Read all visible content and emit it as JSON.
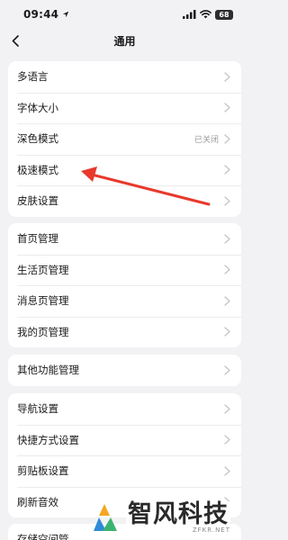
{
  "status_bar": {
    "time": "09:44",
    "battery": "68",
    "icons": [
      "location-arrow-icon",
      "signal-icon",
      "wifi-icon",
      "battery-icon"
    ]
  },
  "nav": {
    "title": "通用",
    "back_icon": "chevron-left-icon"
  },
  "groups": [
    {
      "items": [
        {
          "label": "多语言",
          "value": ""
        },
        {
          "label": "字体大小",
          "value": ""
        },
        {
          "label": "深色模式",
          "value": "已关闭"
        },
        {
          "label": "极速模式",
          "value": ""
        },
        {
          "label": "皮肤设置",
          "value": ""
        }
      ]
    },
    {
      "items": [
        {
          "label": "首页管理",
          "value": ""
        },
        {
          "label": "生活页管理",
          "value": ""
        },
        {
          "label": "消息页管理",
          "value": ""
        },
        {
          "label": "我的页管理",
          "value": ""
        }
      ]
    },
    {
      "items": [
        {
          "label": "其他功能管理",
          "value": ""
        }
      ]
    },
    {
      "items": [
        {
          "label": "导航设置",
          "value": ""
        },
        {
          "label": "快捷方式设置",
          "value": ""
        },
        {
          "label": "剪贴板设置",
          "value": ""
        },
        {
          "label": "刷新音效",
          "value": ""
        }
      ]
    },
    {
      "items": [
        {
          "label": "存储空间管",
          "value": ""
        }
      ]
    }
  ],
  "annotation": {
    "type": "red-arrow",
    "color": "#e8392c",
    "points_to": "极速模式"
  },
  "watermark": {
    "name": "智风科技",
    "domain": "ZFKR.NET",
    "logo_colors": [
      "#f5a623",
      "#2e8bd8",
      "#3cb371"
    ]
  },
  "colors": {
    "background": "#f2f2f4",
    "card": "#ffffff",
    "secondary_text": "#9a9a9e",
    "chevron": "#c4c4c8"
  }
}
